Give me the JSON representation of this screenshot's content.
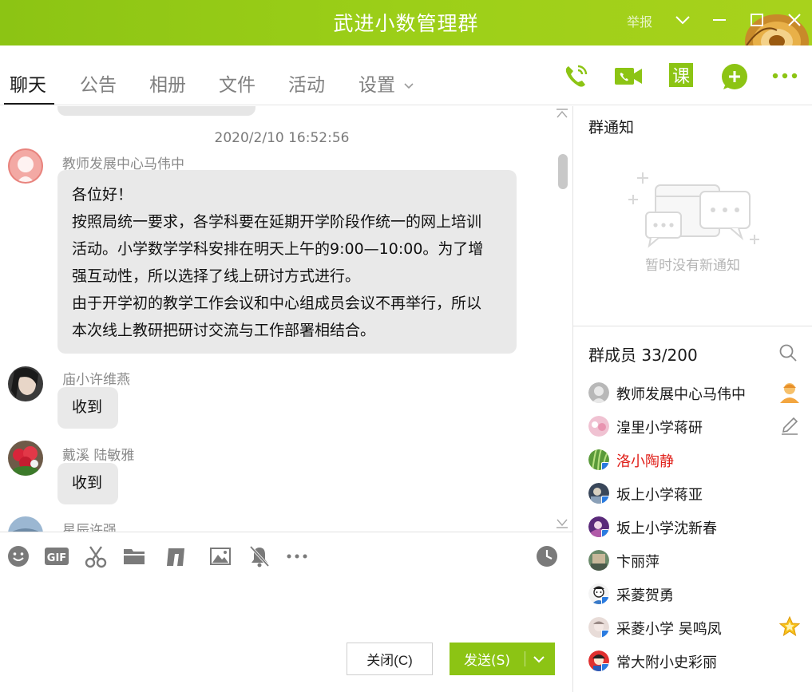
{
  "window": {
    "title": "武进小数管理群",
    "report_label": "举报"
  },
  "tabs": [
    {
      "label": "聊天"
    },
    {
      "label": "公告"
    },
    {
      "label": "相册"
    },
    {
      "label": "文件"
    },
    {
      "label": "活动"
    },
    {
      "label": "设置"
    }
  ],
  "header_icons": [
    "phone-call-icon",
    "video-call-icon",
    "class-icon",
    "add-app-icon",
    "more-icon"
  ],
  "chat": {
    "timestamp": "2020/2/10 16:52:56",
    "messages": [
      {
        "sender": "教师发展中心马伟中",
        "lines": [
          "各位好！",
          "按照局统一要求，各学科要在延期开学阶段作统一的网上培训",
          "活动。小学数学学科安排在明天上午的9:00—10:00。为了增",
          "强互动性，所以选择了线上研讨方式进行。",
          "由于开学初的教学工作会议和中心组成员会议不再举行，所以",
          "本次线上教研把研讨交流与工作部署相结合。"
        ]
      },
      {
        "sender": "庙小许维燕",
        "lines": [
          "收到"
        ]
      },
      {
        "sender": "戴溪  陆敏雅",
        "lines": [
          "收到"
        ]
      },
      {
        "sender": "星辰许强",
        "lines": []
      }
    ]
  },
  "toolbar_icons": [
    "emoji-icon",
    "gif-icon",
    "scissors-icon",
    "folder-icon",
    "shake-icon",
    "image-icon",
    "mute-bell-icon",
    "more-icon",
    "history-clock-icon"
  ],
  "toolbar": {
    "gif_label": "GIF",
    "tone_label": "♫"
  },
  "actions": {
    "close_label": "关闭(C)",
    "send_label": "发送(S)"
  },
  "notice": {
    "title": "群通知",
    "empty_text": "暂时没有新通知"
  },
  "members": {
    "title": "群成员 33/200",
    "list": [
      {
        "name": "教师发展中心马伟中",
        "badge": "owner-icon",
        "highlight": false
      },
      {
        "name": "湟里小学蒋研",
        "badge": "edit-icon",
        "highlight": false
      },
      {
        "name": "洛小陶静",
        "badge": "",
        "highlight": true
      },
      {
        "name": "坂上小学蒋亚",
        "badge": "",
        "highlight": false
      },
      {
        "name": "坂上小学沈新春",
        "badge": "",
        "highlight": false
      },
      {
        "name": "卞丽萍",
        "badge": "",
        "highlight": false
      },
      {
        "name": "采菱贺勇",
        "badge": "",
        "highlight": false
      },
      {
        "name": "采菱小学 吴鸣凤",
        "badge": "star-icon",
        "highlight": false
      },
      {
        "name": "常大附小史彩丽",
        "badge": "",
        "highlight": false
      }
    ]
  },
  "colors": {
    "brand_green": "#8cc414",
    "bubble_gray": "#e9e9e9",
    "highlight_red": "#e0201a"
  }
}
